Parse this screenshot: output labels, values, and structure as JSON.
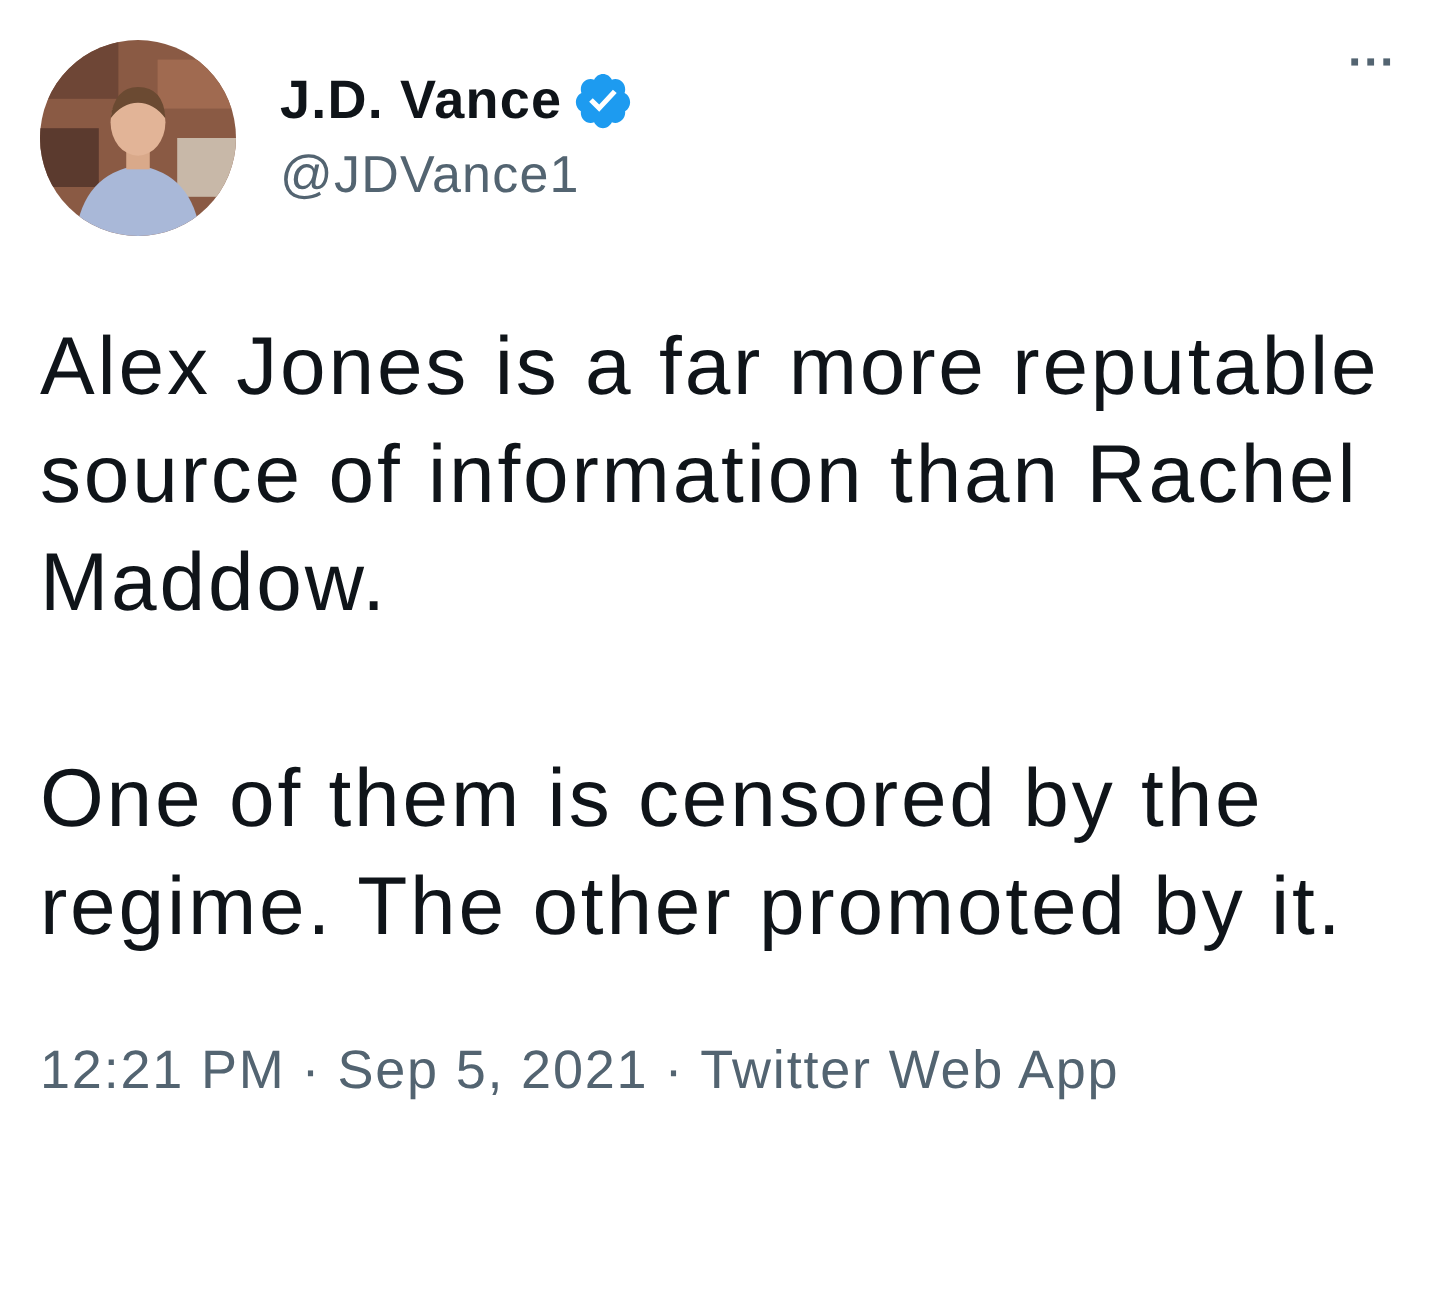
{
  "author": {
    "name": "J.D. Vance",
    "verified": true,
    "handle": "@JDVance1"
  },
  "more_menu": {
    "label": "···"
  },
  "paragraphs": [
    "Alex Jones is a far more reputable source of information than Rachel Maddow.",
    "One of them is censored by the regime. The other promoted by it."
  ],
  "meta": [
    {
      "kind": "time",
      "text": "12:21 PM"
    },
    {
      "kind": "separator",
      "text": "·"
    },
    {
      "kind": "date",
      "text": "Sep 5, 2021"
    },
    {
      "kind": "separator",
      "text": "·"
    },
    {
      "kind": "source",
      "text": "Twitter Web App"
    }
  ]
}
